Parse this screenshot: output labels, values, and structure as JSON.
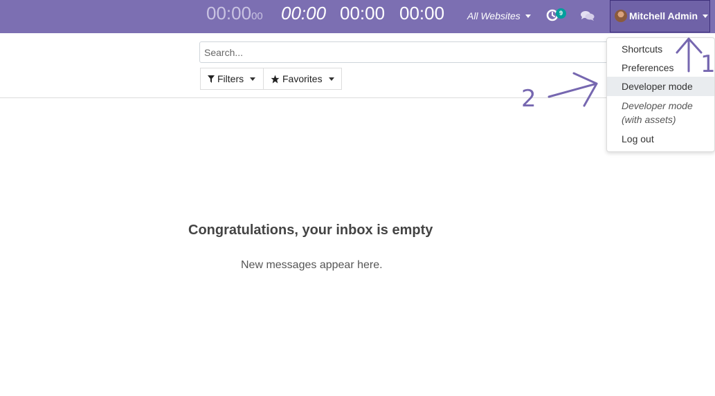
{
  "navbar": {
    "timers": [
      {
        "main": "00:00",
        "small": "00"
      },
      {
        "main": "00:00"
      },
      {
        "main": "00:00"
      },
      {
        "main": "00:00"
      }
    ],
    "websites_label": "All Websites",
    "activity_badge": "9",
    "user_name": "Mitchell Admin",
    "bg_color": "#7c6fb2"
  },
  "control_panel": {
    "search_placeholder": "Search...",
    "filters_label": "Filters",
    "favorites_label": "Favorites"
  },
  "empty_state": {
    "title": "Congratulations, your inbox is empty",
    "text": "New messages appear here."
  },
  "user_menu": {
    "items": [
      {
        "label": "Shortcuts"
      },
      {
        "label": "Preferences"
      },
      {
        "label": "Developer mode",
        "highlighted": true
      },
      {
        "label_line1": "Developer mode",
        "label_line2": "(with assets)"
      },
      {
        "label": "Log out"
      }
    ]
  },
  "annotations": {
    "step_1": "1",
    "step_2": "2",
    "color": "#7667b0"
  }
}
